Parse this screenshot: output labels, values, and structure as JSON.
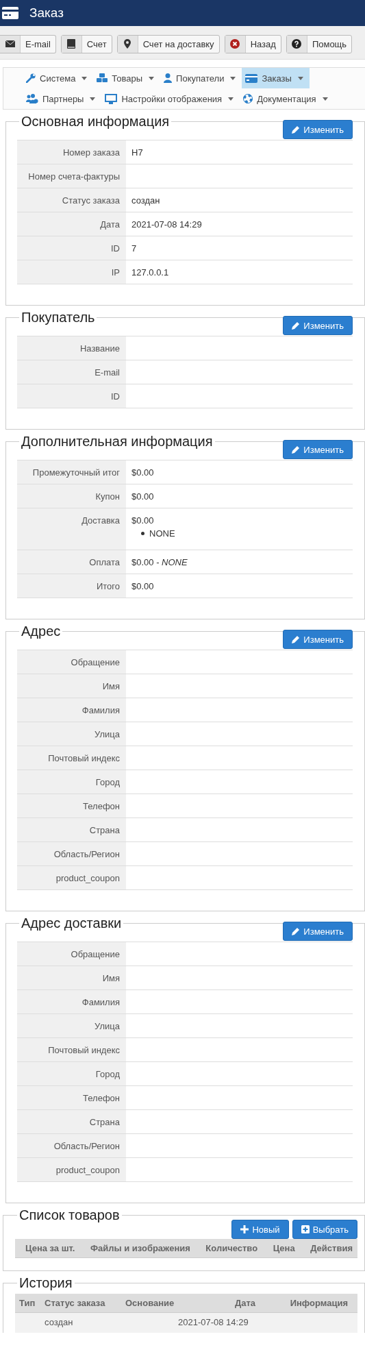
{
  "header": {
    "title": "Заказ"
  },
  "toolbar": [
    {
      "label": "E-mail"
    },
    {
      "label": "Счет"
    },
    {
      "label": "Счет на доставку"
    },
    {
      "label": "Назад"
    },
    {
      "label": "Помощь"
    }
  ],
  "menu": [
    {
      "label": "Система",
      "selected": false
    },
    {
      "label": "Товары",
      "selected": false
    },
    {
      "label": "Покупатели",
      "selected": false
    },
    {
      "label": "Заказы",
      "selected": true
    },
    {
      "label": "Партнеры",
      "selected": false
    },
    {
      "label": "Настройки отображения",
      "selected": false
    },
    {
      "label": "Документация",
      "selected": false
    }
  ],
  "sections": [
    {
      "kind": "info",
      "title": "Основная информация",
      "edit_button": "Изменить",
      "rows": [
        {
          "label": "Номер заказа",
          "value": "H7"
        },
        {
          "label": "Номер счета-фактуры"
        },
        {
          "label": "Статус заказа",
          "value": "создан"
        },
        {
          "label": "Дата",
          "value": "2021-07-08 14:29"
        },
        {
          "label": "ID",
          "value": "7"
        },
        {
          "label": "IP",
          "value": "127.0.0.1"
        }
      ]
    },
    {
      "kind": "info",
      "title": "Покупатель",
      "edit_button": "Изменить",
      "rows": [
        {
          "label": "Название"
        },
        {
          "label": "E-mail"
        },
        {
          "label": "ID"
        }
      ]
    },
    {
      "kind": "info",
      "title": "Дополнительная информация",
      "edit_button": "Изменить",
      "rows": [
        {
          "label": "Промежуточный итог",
          "value": "$0.00"
        },
        {
          "label": "Купон",
          "value": "$0.00"
        },
        {
          "label": "Доставка",
          "value": "$0.00",
          "list": [
            "NONE"
          ]
        },
        {
          "label": "Оплата",
          "value": "$0.00 - *NONE*"
        },
        {
          "label": "Итого",
          "value": "$0.00"
        }
      ]
    },
    {
      "kind": "info",
      "title": "Адрес",
      "edit_button": "Изменить",
      "rows": [
        {
          "label": "Обращение"
        },
        {
          "label": "Имя"
        },
        {
          "label": "Фамилия"
        },
        {
          "label": "Улица"
        },
        {
          "label": "Почтовый индекс"
        },
        {
          "label": "Город"
        },
        {
          "label": "Телефон"
        },
        {
          "label": "Страна"
        },
        {
          "label": "Область/Регион"
        },
        {
          "label": "product_coupon"
        }
      ]
    },
    {
      "kind": "info",
      "title": "Адрес доставки",
      "edit_button": "Изменить",
      "rows": [
        {
          "label": "Обращение"
        },
        {
          "label": "Имя"
        },
        {
          "label": "Фамилия"
        },
        {
          "label": "Улица"
        },
        {
          "label": "Почтовый индекс"
        },
        {
          "label": "Город"
        },
        {
          "label": "Телефон"
        },
        {
          "label": "Страна"
        },
        {
          "label": "Область/Регион"
        },
        {
          "label": "product_coupon"
        }
      ]
    },
    {
      "kind": "products",
      "title": "Список товаров",
      "buttons": [
        "Новый",
        "Выбрать"
      ],
      "columns": [
        "Цена за шт.",
        "Файлы и изображения",
        "Количество",
        "Цена",
        "Действия"
      ]
    },
    {
      "kind": "history",
      "title": "История",
      "columns": [
        "Тип",
        "Статус заказа",
        "Основание",
        "Дата",
        "Информация"
      ],
      "rows": [
        [
          "",
          "создан",
          "",
          "2021-07-08 14:29",
          ""
        ]
      ]
    }
  ]
}
